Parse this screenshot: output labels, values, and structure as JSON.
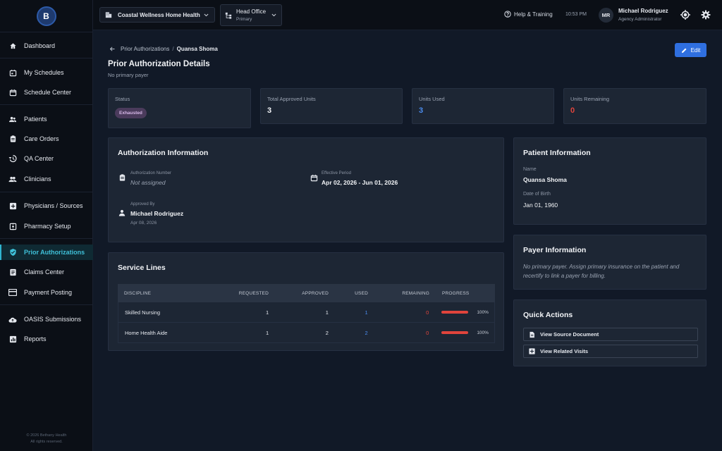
{
  "app": {
    "logo_text": "B"
  },
  "sidebar": {
    "items": [
      {
        "label": "Dashboard",
        "icon": "home-icon"
      },
      {
        "label": "My Schedules",
        "icon": "calendar-check-icon"
      },
      {
        "label": "Schedule Center",
        "icon": "calendar-icon"
      },
      {
        "label": "Patients",
        "icon": "people-icon"
      },
      {
        "label": "Care Orders",
        "icon": "clipboard-icon"
      },
      {
        "label": "QA Center",
        "icon": "history-icon"
      },
      {
        "label": "Clinicians",
        "icon": "group-icon"
      },
      {
        "label": "Physicians / Sources",
        "icon": "plus-box-icon"
      },
      {
        "label": "Pharmacy Setup",
        "icon": "settings-grid-icon"
      },
      {
        "label": "Prior Authorizations",
        "icon": "shield-check-icon",
        "active": true
      },
      {
        "label": "Claims Center",
        "icon": "list-doc-icon"
      },
      {
        "label": "Payment Posting",
        "icon": "credit-card-icon"
      },
      {
        "label": "OASIS Submissions",
        "icon": "cloud-upload-icon"
      },
      {
        "label": "Reports",
        "icon": "bar-chart-icon"
      }
    ],
    "footer_line1": "© 2026 Bethany Health",
    "footer_line2": "All rights reserved."
  },
  "topbar": {
    "organization": "Coastal Wellness Home Health",
    "office_name": "Head Office",
    "office_type": "Primary",
    "help_label": "Help & Training",
    "time": "10:53 PM",
    "avatar_initials": "MR",
    "user_name": "Michael Rodriguez",
    "user_role": "Agency Administrator"
  },
  "breadcrumb": {
    "parent": "Prior Authorizations",
    "separator": "/",
    "current": "Quansa Shoma"
  },
  "page": {
    "title": "Prior Authorization Details",
    "subtitle": "No primary payer",
    "edit_label": "Edit"
  },
  "stats": {
    "status_label": "Status",
    "status_value": "Exhausted",
    "total_label": "Total Approved Units",
    "total_value": "3",
    "used_label": "Units Used",
    "used_value": "3",
    "remaining_label": "Units Remaining",
    "remaining_value": "0"
  },
  "authorization": {
    "title": "Authorization Information",
    "number_label": "Authorization Number",
    "number_value": "Not assigned",
    "period_label": "Effective Period",
    "period_value": "Apr 02, 2026 - Jun 01, 2026",
    "approved_label": "Approved By",
    "approved_value": "Michael Rodriguez",
    "approved_date": "Apr 08, 2026"
  },
  "service_lines": {
    "title": "Service Lines",
    "headers": {
      "discipline": "Discipline",
      "requested": "Requested",
      "approved": "Approved",
      "used": "Used",
      "remaining": "Remaining",
      "progress": "Progress"
    },
    "rows": [
      {
        "discipline": "Skilled Nursing",
        "requested": "1",
        "approved": "1",
        "used": "1",
        "remaining": "0",
        "progress": "100%",
        "progress_value": 1.0
      },
      {
        "discipline": "Home Health Aide",
        "requested": "1",
        "approved": "2",
        "used": "2",
        "remaining": "0",
        "progress": "100%",
        "progress_value": 1.0
      }
    ]
  },
  "patient": {
    "title": "Patient Information",
    "name_label": "Name",
    "name_value": "Quansa Shoma",
    "dob_label": "Date of Birth",
    "dob_value": "Jan 01, 1960"
  },
  "payer": {
    "title": "Payer Information",
    "text": "No primary payer. Assign primary insurance on the patient and recertify to link a payer for billing."
  },
  "quick_actions": {
    "title": "Quick Actions",
    "view_source": "View Source Document",
    "view_visits": "View Related Visits"
  },
  "colors": {
    "accent": "#2f6fe0",
    "active_nav": "#3fc0d8",
    "used_blue": "#4b8df0",
    "remaining_red": "#e0443c",
    "badge_bg": "#4b3b5c"
  }
}
